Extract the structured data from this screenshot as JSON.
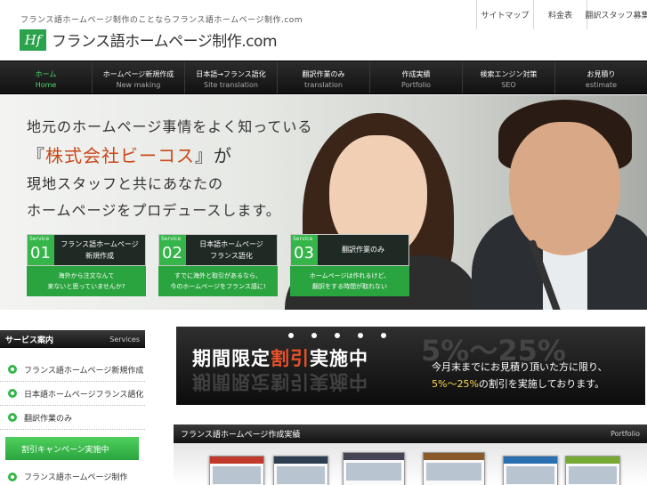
{
  "header": {
    "tagline": "フランス語ホームページ制作のことならフランス語ホームページ制作.com",
    "logo_mark": "Hf",
    "logo_text": "フランス語ホームページ制作.com",
    "top_links": [
      "サイトマップ",
      "料金表",
      "翻訳スタッフ募集"
    ]
  },
  "nav": [
    {
      "jp": "ホーム",
      "en": "Home"
    },
    {
      "jp": "ホームページ新規作成",
      "en": "New making"
    },
    {
      "jp": "日本語→フランス語化",
      "en": "Site translation"
    },
    {
      "jp": "翻訳作業のみ",
      "en": "translation"
    },
    {
      "jp": "作成実績",
      "en": "Portfolio"
    },
    {
      "jp": "検索エンジン対策",
      "en": "SEO"
    },
    {
      "jp": "お見積り",
      "en": "estimate"
    }
  ],
  "hero": {
    "line1": "地元のホームページ事情をよく知っている",
    "line2_open": "『",
    "line2_company": "株式会社ビーコス",
    "line2_close": "』が",
    "line3": "現地スタッフと共にあなたの",
    "line4": "ホームページをプロデュースします。",
    "services": [
      {
        "word": "Service",
        "num": "01",
        "title1": "フランス語ホームページ",
        "title2": "新規作成",
        "desc1": "海外から注文なんて",
        "desc2": "来ないと思っていませんか?"
      },
      {
        "word": "Service",
        "num": "02",
        "title1": "日本語ホームページ",
        "title2": "フランス語化",
        "desc1": "すでに海外と取引があるなら、",
        "desc2": "今のホームページをフランス語に!"
      },
      {
        "word": "Service",
        "num": "03",
        "title1": "翻訳作業のみ",
        "title2": "",
        "desc1": "ホームページは作れるけど、",
        "desc2": "翻訳をする時間が取れない"
      }
    ]
  },
  "sidebar": {
    "title": "サービス案内",
    "title_en": "Services",
    "items": [
      "フランス語ホームページ新規作成",
      "日本語ホームページフランス語化",
      "翻訳作業のみ"
    ],
    "cta": "割引キャンペーン実施中",
    "next_item": "フランス語ホームページ制作"
  },
  "banner": {
    "title_a": "期間限定",
    "title_b": "割引",
    "title_c": "実施中",
    "bg_text": "5%～25%",
    "sub1": "今月末までにお見積り頂いた方に限り、",
    "sub2_hl": "5%～25%",
    "sub2_rest": "の割引を実施しております。"
  },
  "portfolio": {
    "title": "フランス語ホームページ作成実績",
    "title_en": "Portfolio"
  },
  "colors": {
    "accent": "#35b54a",
    "nav_bg": "#1a1a1a",
    "red": "#c9481a"
  }
}
